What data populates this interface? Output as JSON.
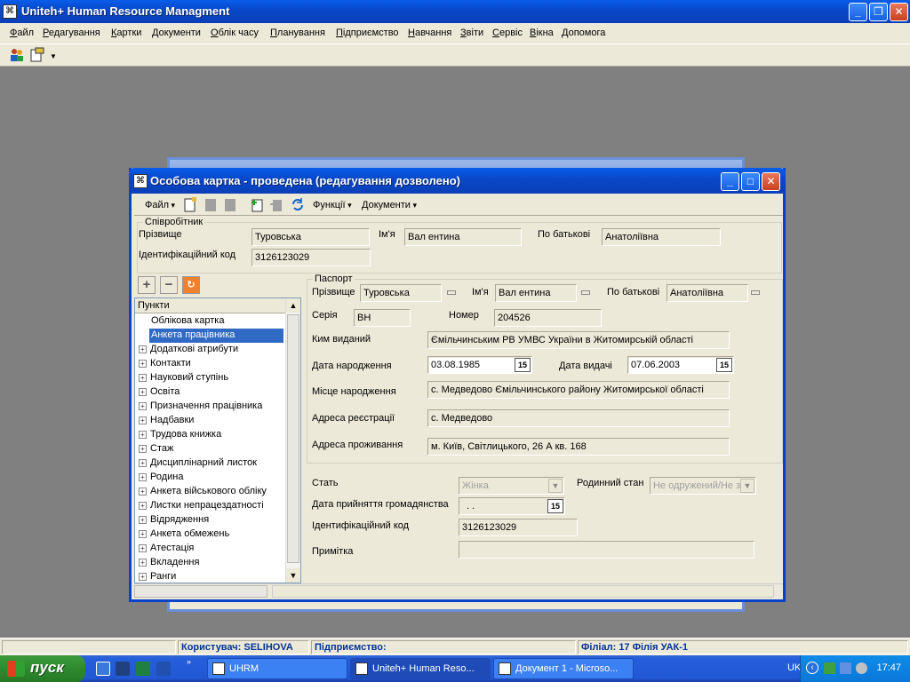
{
  "app": {
    "title": "Uniteh+ Human Resource Managment",
    "icon": "app-icon"
  },
  "menu": [
    "Файл",
    "Редагування",
    "Картки",
    "Документи",
    "Облік часу",
    "Планування",
    "Підприємство",
    "Навчання",
    "Звіти",
    "Сервіс",
    "Вікна",
    "Допомога"
  ],
  "child": {
    "title": "Особова картка - проведена (редагування дозволено)",
    "toolbar": {
      "file": "Файл",
      "functions": "Функції",
      "documents": "Документи"
    },
    "employee": {
      "legend": "Співробітник",
      "surname_label": "Прізвище",
      "surname": "Туровська",
      "name_label": "Ім'я",
      "name": "Вал ентина",
      "patronymic_label": "По батькові",
      "patronymic": "Анатоліївна",
      "id_label": "Ідентифікаційний код",
      "id": "3126123029"
    },
    "tree": {
      "header": "Пункти",
      "leaves": [
        "Облікова картка",
        "Анкета працівника"
      ],
      "selected": "Анкета працівника",
      "items": [
        "Додаткові атрибути",
        "Контакти",
        "Науковий ступінь",
        "Освіта",
        "Призначення працівника",
        "Надбавки",
        "Трудова книжка",
        "Стаж",
        "Дисциплінарний листок",
        "Родина",
        "Анкета військового обліку",
        "Листки непрацездатності",
        "Відрядження",
        "Анкета обмежень",
        "Атестація",
        "Вкладення",
        "Ранги"
      ]
    },
    "passport": {
      "legend": "Паспорт",
      "surname_label": "Прізвище",
      "surname": "Туровська",
      "name_label": "Ім'я",
      "name": "Вал ентина",
      "patronymic_label": "По батькові",
      "patronymic": "Анатоліївна",
      "series_label": "Серія",
      "series": "ВН",
      "number_label": "Номер",
      "number": "204526",
      "issued_by_label": "Ким виданий",
      "issued_by": "Ємільчинським РВ УМВС України в Житомирській області",
      "birth_date_label": "Дата народження",
      "birth_date": "03.08.1985",
      "issue_date_label": "Дата видачі",
      "issue_date": "07.06.2003",
      "birth_place_label": "Місце народження",
      "birth_place": "с. Медведово Ємільчинського району Житомирської області",
      "reg_address_label": "Адреса реєстрації",
      "reg_address": "с. Медведово",
      "live_address_label": "Адреса проживання",
      "live_address": "м. Київ, Світлицького, 26 А кв. 168"
    },
    "extra": {
      "sex_label": "Стать",
      "sex": "Жінка",
      "marital_label": "Родинний стан",
      "marital": "Не одружений/Не з",
      "citizenship_date_label": "Дата прийняття громадянства",
      "citizenship_date": ". .",
      "id_label": "Ідентифікаційний код",
      "id": "3126123029",
      "note_label": "Примітка",
      "note": ""
    },
    "calendar_icon_text": "15"
  },
  "status": {
    "user": "Користувач: SELIHOVA",
    "company": "Підприємство:",
    "branch": "Філіал: 17 Філія УАК-1"
  },
  "taskbar": {
    "start": "пуск",
    "tasks": [
      "UHRM",
      "Uniteh+ Human Reso...",
      "Документ 1 - Microso..."
    ],
    "lang": "UK",
    "clock": "17:47"
  }
}
